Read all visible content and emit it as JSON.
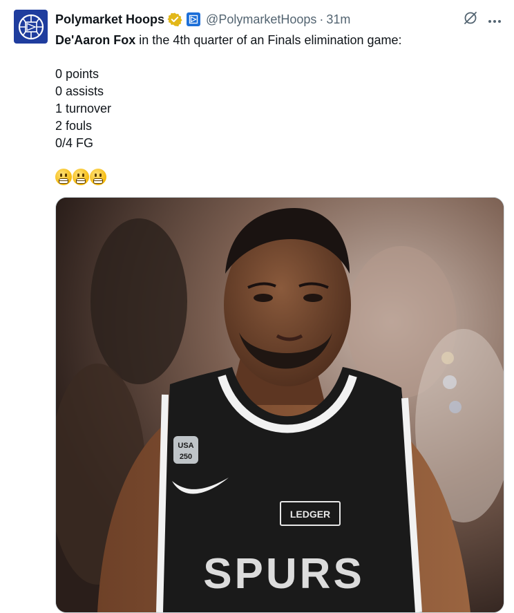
{
  "post": {
    "display_name": "Polymarket Hoops",
    "handle": "@PolymarketHoops",
    "separator": "·",
    "time": "31m",
    "mention": "De'Aaron Fox",
    "text_rest": " in the 4th quarter of an Finals elimination game:",
    "stat_lines": [
      "0 points",
      "0 assists",
      "1 turnover",
      "2 fouls",
      "0/4 FG"
    ],
    "emojis": [
      "grimacing-face",
      "grimacing-face",
      "grimacing-face"
    ]
  },
  "media": {
    "jersey_team": "SPURS",
    "patch_text": "LEDGER",
    "badge_top": "USA",
    "badge_bottom": "250"
  },
  "icons": {
    "verified": "verified-badge-gold-icon",
    "affiliate": "affiliate-badge-icon",
    "grok": "grok-icon",
    "more": "more-options-icon"
  },
  "colors": {
    "text": "#0f1419",
    "muted": "#536471",
    "verified_gold": "#e2b719",
    "affiliate_blue": "#1d6fd8",
    "avatar_bg": "#1f3d9e"
  }
}
